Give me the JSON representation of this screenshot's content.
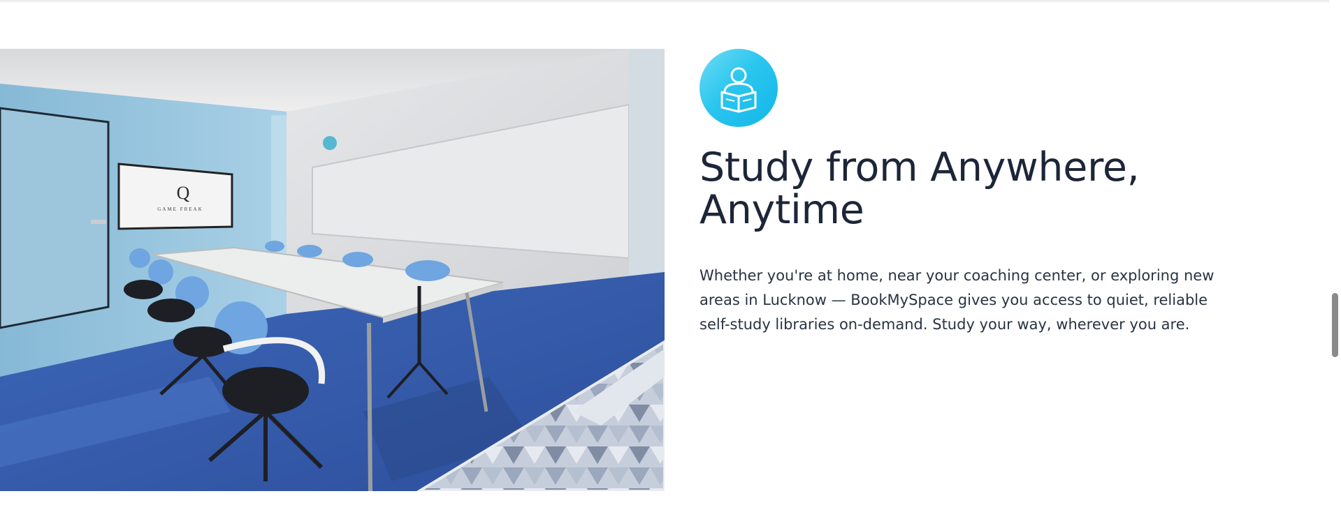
{
  "section": {
    "icon": "reading-person-icon",
    "heading": "Study from Anywhere, Anytime",
    "description": "Whether you're at home, near your coaching center, or exploring new areas in Lucknow — BookMySpace gives you access to quiet, reliable self-study libraries on-demand. Study your way, wherever you are.",
    "photo": {
      "subject": "meeting-room-photo",
      "tv_brand": "GAME FREAK"
    }
  },
  "colors": {
    "icon_gradient_start": "#6fdcf5",
    "icon_gradient_end": "#12b6ea",
    "heading": "#1d2638",
    "body_text": "#2a3342"
  }
}
